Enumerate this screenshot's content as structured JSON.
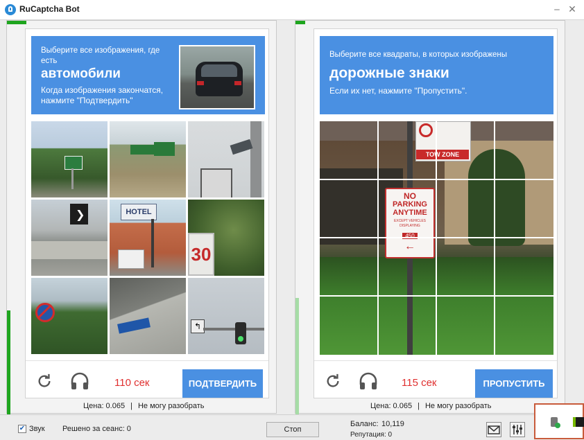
{
  "window": {
    "title": "RuCaptcha Bot"
  },
  "left_task": {
    "instruction_top": "Выберите все изображения, где есть",
    "target": "автомобили",
    "instruction_bottom": "Когда изображения закончатся, нажмите \"Подтвердить\"",
    "timer": "110 сек",
    "action_label": "ПОДТВЕРДИТЬ",
    "tiles": [
      "road-sign",
      "highway-road",
      "street-sign",
      "road-barrier",
      "hotel-building",
      "speed-sign",
      "no-parking-sign",
      "street-corner",
      "traffic-light"
    ],
    "progress": 1.0
  },
  "right_task": {
    "instruction_top": "Выберите все квадраты, в которых изображены",
    "target": "дорожные знаки",
    "instruction_bottom": "Если их нет, нажмите \"Пропустить\".",
    "timer": "115 сек",
    "action_label": "ПРОПУСТИТЬ",
    "grid_size": 4,
    "progress": 0.02
  },
  "sign": {
    "line1": "NO",
    "line2": "PARKING",
    "line3": "ANYTIME",
    "small1": "EXCEPT VEHICLES",
    "small2": "DISPLAYING",
    "permit": "450",
    "tow_zone": "TOW ZONE"
  },
  "hotel_sign": "HOTEL",
  "speed_sign": "30",
  "footer": {
    "price_label": "Цена: 0.065",
    "cant_solve": "Не могу разобрать"
  },
  "bottom": {
    "sound_label": "Звук",
    "sound_checked": true,
    "solved_label": "Решено за сеанс: 0",
    "stop_label": "Стоп",
    "balance_label": "Баланс:",
    "balance_value": "10,119",
    "reputation": "Репутация: 0"
  },
  "icons": [
    "reload-icon",
    "headphones-icon",
    "mail-icon",
    "settings-sliders-icon",
    "app-icon"
  ],
  "colors": {
    "accent": "#4a90e2",
    "timer": "#e03030",
    "progress": "#1ea51e"
  }
}
